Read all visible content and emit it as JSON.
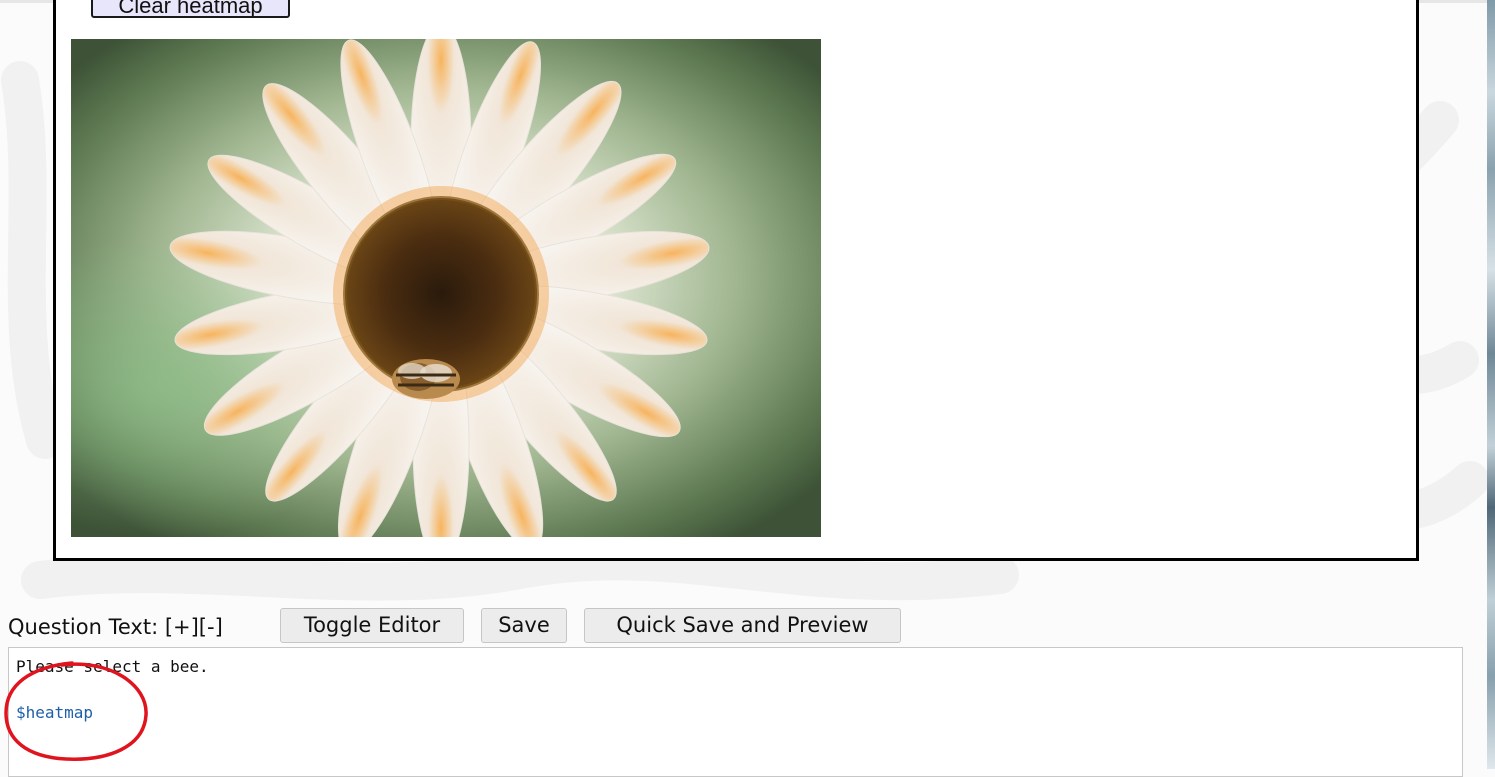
{
  "preview": {
    "clear_button_label": "Clear heatmap",
    "image_alt": "White sunflower with a bee on its center"
  },
  "question_editor": {
    "label": "Question Text: [+][-]",
    "toggle_editor_label": "Toggle Editor",
    "save_label": "Save",
    "quick_save_label": "Quick Save and Preview",
    "content_line_1": "Please select a bee.",
    "content_line_2": "$heatmap"
  },
  "colors": {
    "annotation_circle": "#e0141e",
    "variable_token": "#1f5fa8",
    "button_background": "#ececec",
    "clear_button_background": "#e8e6fa"
  },
  "icons": {
    "annotation": "red-ellipse-marker"
  }
}
